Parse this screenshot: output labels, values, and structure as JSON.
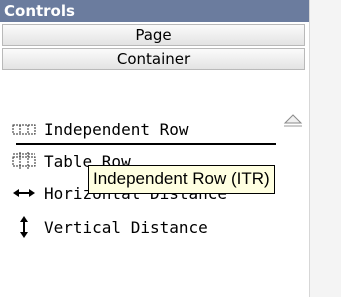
{
  "panel": {
    "title": "Controls",
    "nav": [
      {
        "label": "Page"
      },
      {
        "label": "Container"
      }
    ]
  },
  "controls": [
    {
      "label": "Independent Row",
      "icon": "independent-row-icon"
    },
    {
      "label": "Table Row",
      "icon": "table-row-icon"
    },
    {
      "label": "Horizontal Distance",
      "icon": "horizontal-distance-icon"
    },
    {
      "label": "Vertical Distance",
      "icon": "vertical-distance-icon"
    }
  ],
  "tooltip": {
    "text": "Independent Row (ITR)"
  },
  "colors": {
    "header_bg": "#6b7c9e",
    "tooltip_bg": "#ffffe1"
  }
}
